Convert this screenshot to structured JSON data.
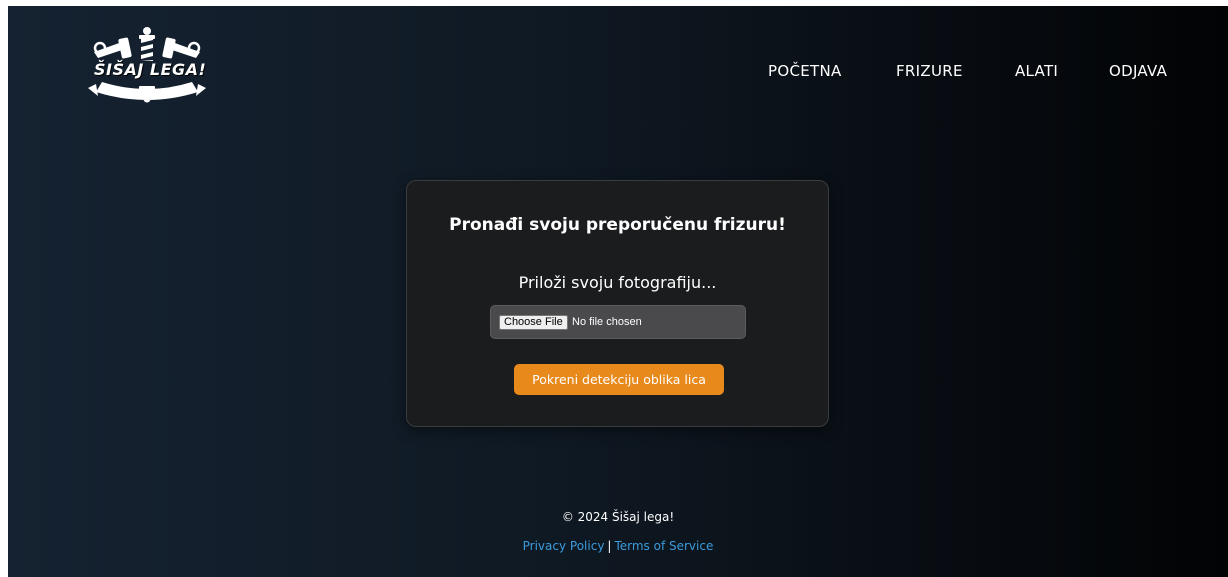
{
  "brand": {
    "logo_text": "ŠIŠAJ LEGA!"
  },
  "nav": {
    "items": [
      {
        "label": "POČETNA"
      },
      {
        "label": "FRIZURE"
      },
      {
        "label": "ALATI"
      },
      {
        "label": "ODJAVA"
      }
    ]
  },
  "card": {
    "title": "Pronađi svoju preporučenu frizuru!",
    "subtitle": "Priloži svoju fotografiju...",
    "file_input": {
      "button_label": "Choose File",
      "status": "No file chosen"
    },
    "detect_button_label": "Pokreni detekciju oblika lica"
  },
  "footer": {
    "copyright": "© 2024 Šišaj lega!",
    "privacy_label": "Privacy Policy",
    "separator": "|",
    "terms_label": "Terms of Service"
  },
  "colors": {
    "accent": "#e8891c",
    "link": "#3b9bdc",
    "card_bg": "#1b1c1e"
  }
}
